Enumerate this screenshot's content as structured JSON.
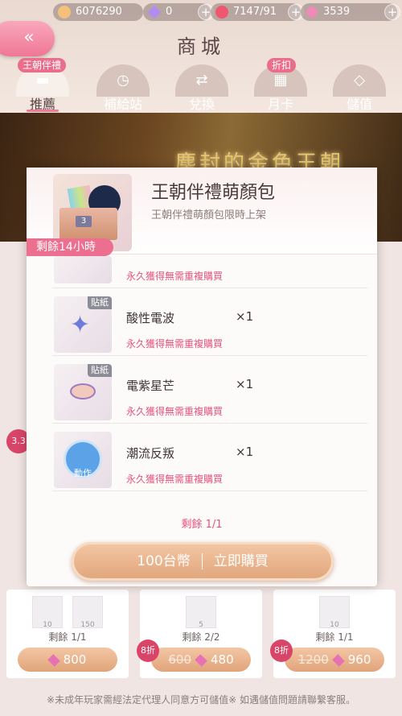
{
  "currency": [
    {
      "value": "6076290",
      "icon": "cat-coin-icon",
      "color": "#f4c07a"
    },
    {
      "value": "0",
      "icon": "purple-gem-icon",
      "color": "#b38cf0"
    },
    {
      "value": "7147/91",
      "icon": "heart-icon",
      "color": "#f0566f"
    },
    {
      "value": "3539",
      "icon": "pink-diamond-icon",
      "color": "#f08ab8"
    }
  ],
  "header": {
    "back_icon": "«",
    "title": "商城"
  },
  "tabs": [
    {
      "label": "推薦",
      "icon": "gift-bag-icon",
      "tag": "王朝伴禮",
      "active": true
    },
    {
      "label": "補給站",
      "icon": "clock-icon",
      "tag": "",
      "active": false
    },
    {
      "label": "兌換",
      "icon": "exchange-icon",
      "tag": "",
      "active": false
    },
    {
      "label": "月卡",
      "icon": "calendar-icon",
      "tag": "折扣",
      "active": false
    },
    {
      "label": "儲值",
      "icon": "diamond-icon",
      "tag": "",
      "active": false
    }
  ],
  "banner": {
    "title": "塵封的金色王朝"
  },
  "modal": {
    "title": "王朝伴禮萌顏包",
    "subtitle": "王朝伴禮萌顏包限時上架",
    "timer": "剩餘14小時",
    "hero_count": "3",
    "top_note": "永久獲得無需重複購買",
    "items": [
      {
        "name": "酸性電波",
        "qty": "×1",
        "note": "永久獲得無需重複購買",
        "badge": "貼紙",
        "icon": "star-sticker-icon"
      },
      {
        "name": "電紫星芒",
        "qty": "×1",
        "note": "永久獲得無需重複購買",
        "badge": "貼紙",
        "icon": "eye-sticker-icon"
      },
      {
        "name": "潮流反叛",
        "qty": "×1",
        "note": "永久獲得無需重複購買",
        "badge": "",
        "icon": "action-pose-icon",
        "icon_label": "動作"
      }
    ],
    "remain": "剩餘 1/1",
    "price": "100台幣",
    "buy_label": "立即購買"
  },
  "cards": [
    {
      "remain": "剩餘 1/1",
      "price": "800",
      "old_price": "",
      "discount": "",
      "items": [
        "10",
        "150"
      ]
    },
    {
      "remain": "剩餘 2/2",
      "price": "480",
      "old_price": "600",
      "discount": "8折",
      "items": [
        "5"
      ]
    },
    {
      "remain": "剩餘 1/1",
      "price": "960",
      "old_price": "1200",
      "discount": "8折",
      "items": [
        "10"
      ]
    }
  ],
  "side": {
    "discount_left": "3.3"
  },
  "footer": "※未成年玩家需經法定代理人同意方可儲值※ 如遇儲值問題請聯繫客服。"
}
